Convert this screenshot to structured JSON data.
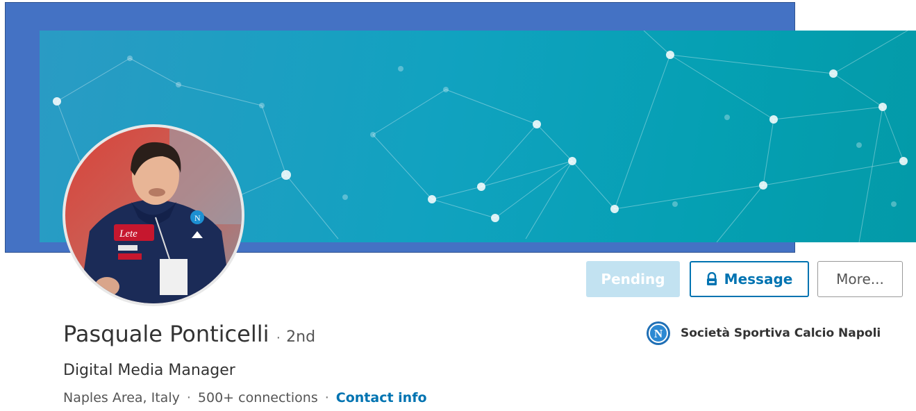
{
  "profile": {
    "name": "Pasquale Ponticelli",
    "separator": "·",
    "degree": "2nd",
    "headline": "Digital Media Manager",
    "location": "Naples Area, Italy",
    "connections": "500+ connections",
    "contact_label": "Contact info"
  },
  "actions": {
    "pending_label": "Pending",
    "message_label": "Message",
    "more_label": "More..."
  },
  "company": {
    "name": "Società Sportiva Calcio Napoli",
    "logo_letter": "N"
  },
  "colors": {
    "accent": "#0073b1",
    "pending_bg": "#c2e2f1",
    "cover_teal": "#05a0b3",
    "background_panel": "#4472c4"
  }
}
